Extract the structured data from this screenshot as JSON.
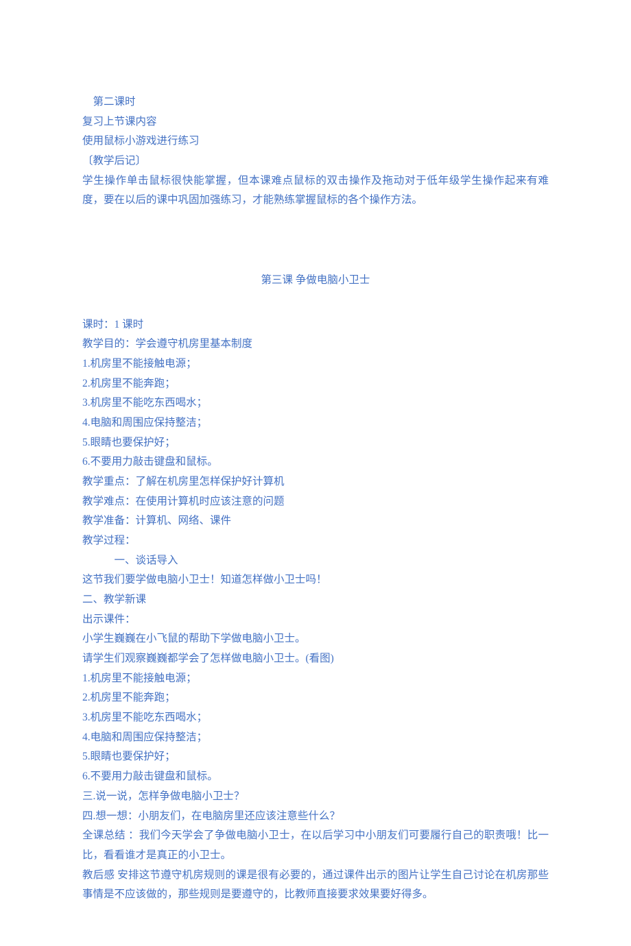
{
  "top": {
    "line1": "  第二课时",
    "line2": "复习上节课内容",
    "line3": "使用鼠标小游戏进行练习",
    "line4": "〔教学后记〕",
    "line5": "学生操作单击鼠标很快能掌握，但本课难点鼠标的双击操作及拖动对于低年级学生操作起来有难度，要在以后的课中巩固加强练习，才能熟练掌握鼠标的各个操作方法。"
  },
  "section_title": "第三课 争做电脑小卫士",
  "body": {
    "l1": "课时：1 课时",
    "l2": "教学目的：学会遵守机房里基本制度",
    "l3": "1.机房里不能接触电源；",
    "l4": "2.机房里不能奔跑；",
    "l5": "3.机房里不能吃东西喝水；",
    "l6": "4.电脑和周围应保持整洁；",
    "l7": "5.眼睛也要保护好；",
    "l8": "6.不要用力敲击键盘和鼠标。",
    "l9": "教学重点：了解在机房里怎样保护好计算机",
    "l10": "教学难点：在使用计算机时应该注意的问题",
    "l11": "教学准备：计算机、网络、课件",
    "l12": "教学过程：",
    "l13": "一、谈话导入",
    "l14": "这节我们要学做电脑小卫士！知道怎样做小卫士吗！",
    "l15": "二、教学新课",
    "l16": "出示课件：",
    "l17": "小学生巍巍在小飞鼠的帮助下学做电脑小卫士。",
    "l18": "请学生们观察巍巍都学会了怎样做电脑小卫士。(看图)",
    "l19": "1.机房里不能接触电源；",
    "l20": "2.机房里不能奔跑；",
    "l21": "3.机房里不能吃东西喝水；",
    "l22": "4.电脑和周围应保持整洁；",
    "l23": "5.眼睛也要保护好；",
    "l24": "6.不要用力敲击键盘和鼠标。",
    "l25": "三.说一说，怎样争做电脑小卫士？",
    "l26": "四.想一想：小朋友们，在电脑房里还应该注意些什么？",
    "l27": "全课总结 ：我们今天学会了争做电脑小卫士，在以后学习中小朋友们可要履行自己的职责哦！比一比，看看谁才是真正的小卫士。",
    "l28": "教后感 安排这节遵守机房规则的课是很有必要的，通过课件出示的图片让学生自己讨论在机房那些事情是不应该做的，那些规则是要遵守的，比教师直接要求效果要好得多。"
  }
}
